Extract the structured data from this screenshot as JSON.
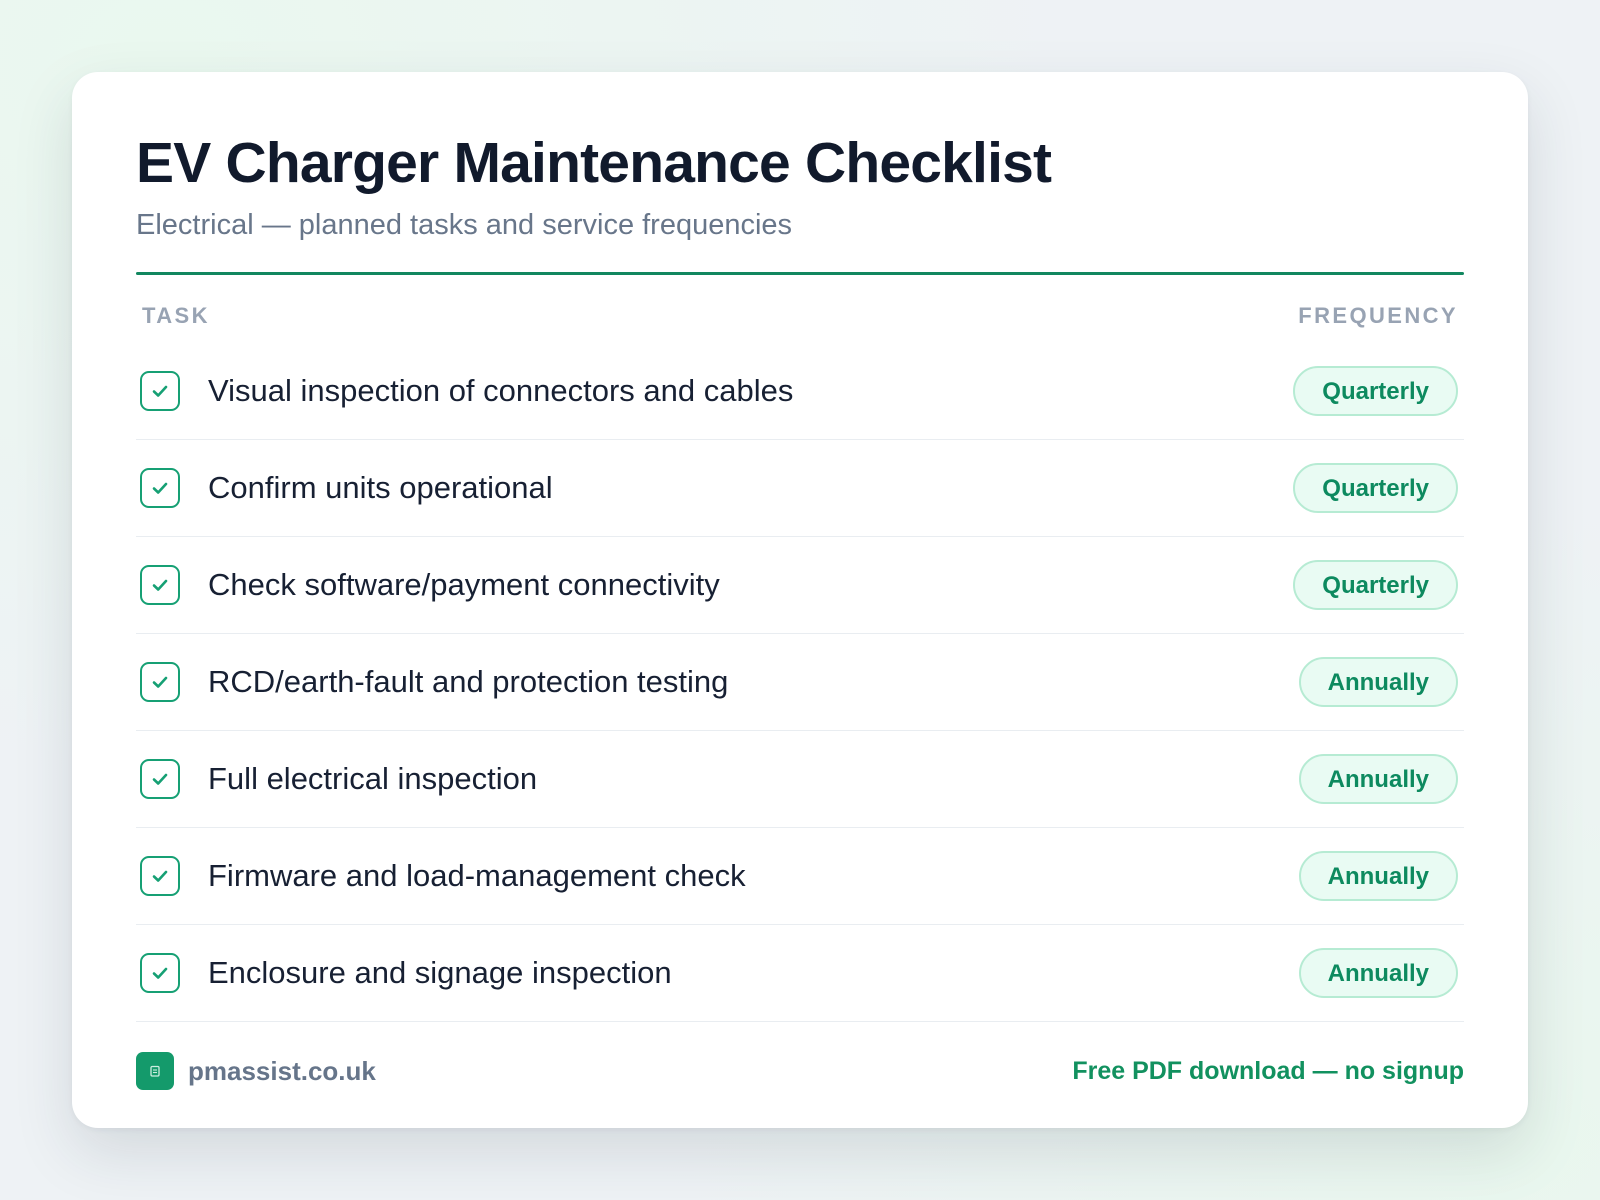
{
  "header": {
    "title": "EV Charger Maintenance Checklist",
    "subtitle": "Electrical — planned tasks and service frequencies"
  },
  "columns": {
    "task": "TASK",
    "frequency": "FREQUENCY"
  },
  "tasks": [
    {
      "label": "Visual inspection of connectors and cables",
      "frequency": "Quarterly",
      "checked": true
    },
    {
      "label": "Confirm units operational",
      "frequency": "Quarterly",
      "checked": true
    },
    {
      "label": "Check software/payment connectivity",
      "frequency": "Quarterly",
      "checked": true
    },
    {
      "label": "RCD/earth-fault and protection testing",
      "frequency": "Annually",
      "checked": true
    },
    {
      "label": "Full electrical inspection",
      "frequency": "Annually",
      "checked": true
    },
    {
      "label": "Firmware and load-management check",
      "frequency": "Annually",
      "checked": true
    },
    {
      "label": "Enclosure and signage inspection",
      "frequency": "Annually",
      "checked": true
    }
  ],
  "footer": {
    "brand_icon": "document-icon",
    "domain": "pmassist.co.uk",
    "cta": "Free PDF download — no signup"
  },
  "colors": {
    "accent": "#11875f",
    "pill_bg": "#e9fbf3",
    "pill_border": "#b6ebd3",
    "text": "#111a2c"
  }
}
